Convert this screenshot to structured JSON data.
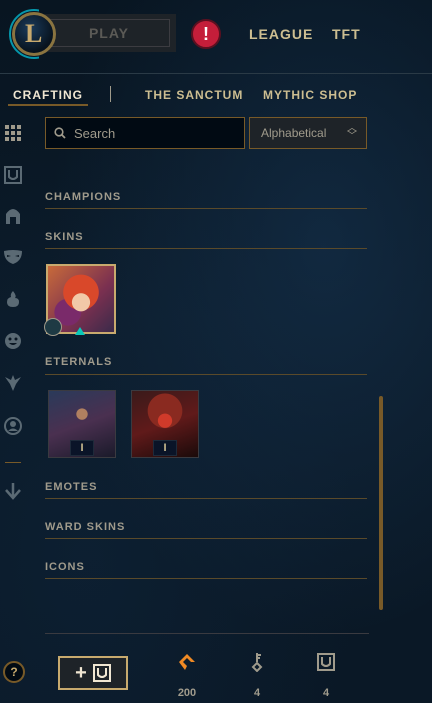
{
  "header": {
    "play_label": "PLAY",
    "alert_glyph": "!",
    "nav": [
      "LEAGUE",
      "TFT"
    ]
  },
  "subnav": {
    "tabs": [
      "CRAFTING",
      "THE SANCTUM",
      "MYTHIC SHOP"
    ]
  },
  "toolbar": {
    "search_placeholder": "Search",
    "sort_selected": "Alphabetical"
  },
  "sections": {
    "champions": "CHAMPIONS",
    "skins": "SKINS",
    "eternals": "ETERNALS",
    "emotes": "EMOTES",
    "ward_skins": "WARD SKINS",
    "icons": "ICONS"
  },
  "eternals": {
    "items": [
      {
        "series": "I"
      },
      {
        "series": "I"
      }
    ]
  },
  "footer": {
    "help_glyph": "?",
    "add_glyph": "+",
    "currencies": [
      {
        "icon": "orange-essence-icon",
        "value": "200"
      },
      {
        "icon": "key-icon",
        "value": "4"
      },
      {
        "icon": "chest-icon",
        "value": "4"
      }
    ]
  },
  "sidebar": {
    "icons": [
      "grid-icon",
      "chest-icon",
      "helmet-icon",
      "mask-icon",
      "flame-icon",
      "emote-icon",
      "ward-icon",
      "profile-icon",
      "arrow-down-icon"
    ]
  },
  "colors": {
    "gold": "#c8aa6e",
    "dark_gold": "#785a28",
    "text": "#a09b8c",
    "alert_red": "#c41e3a",
    "orange_essence": "#f08a24"
  }
}
